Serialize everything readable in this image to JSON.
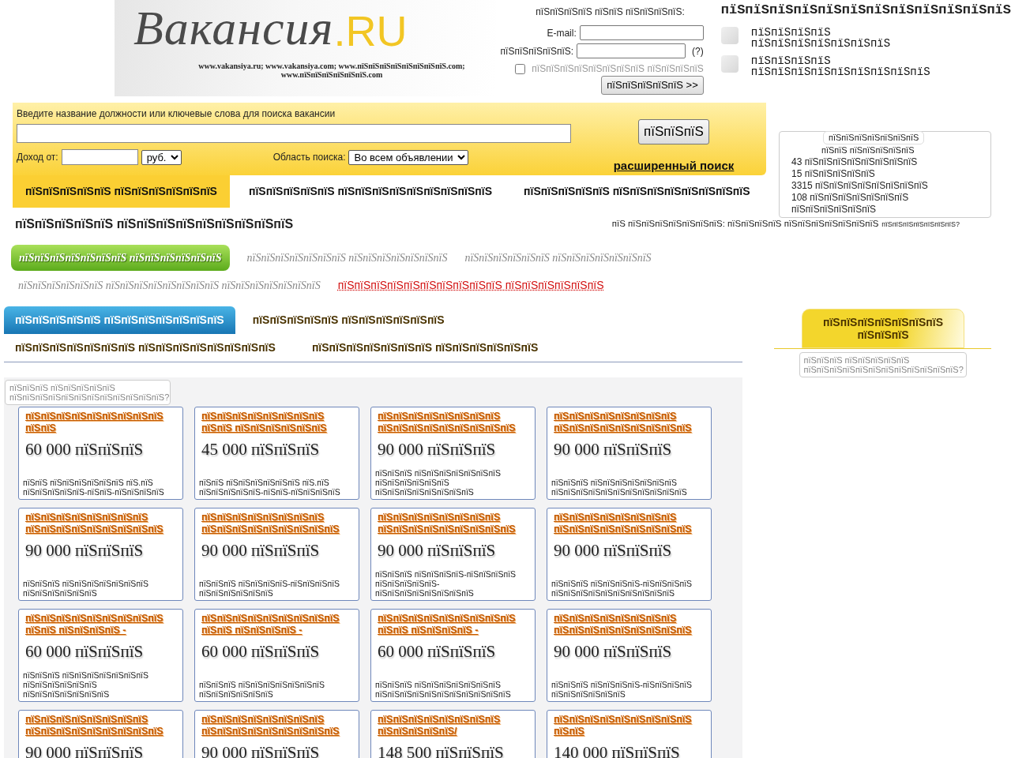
{
  "header": {
    "logo_text": "Вакансия",
    "logo_suffix": ".RU",
    "domains": "www.vakansiya.ru; www.vakansiya.com; www.пїЅпїЅпїЅпїЅпїЅпїЅпїЅпїЅ.com; www.пїЅпїЅпїЅпїЅпїЅпїЅ.com"
  },
  "login": {
    "title": "пїЅпїЅпїЅпїЅ пїЅпїЅ пїЅпїЅпїЅпїЅ:",
    "email_label": "E-mail:",
    "password_label": "пїЅпїЅпїЅпїЅпїЅ:",
    "help": "(?)",
    "remember": {
      "label": "пїЅпїЅпїЅпїЅпїЅпїЅпїЅпїЅ пїЅпїЅпїЅпїЅ",
      "checked": false
    },
    "button": "пїЅпїЅпїЅпїЅпїЅ >>"
  },
  "account": {
    "heading": "пїЅпїЅпїЅпїЅпїЅпїЅпїЅпїЅпїЅпїЅпїЅпїЅ",
    "links": [
      "пїЅпїЅпїЅпїЅ пїЅпїЅпїЅпїЅпїЅпїЅпїЅ",
      "пїЅпїЅпїЅпїЅ пїЅпїЅпїЅпїЅпїЅпїЅпїЅпїЅпїЅ"
    ]
  },
  "search": {
    "label": "Введите название должности или ключевые слова для поиска вакансии",
    "button": "пїЅпїЅпїЅ",
    "income_label": "Доход от:",
    "currency": "руб.",
    "area_label": "Область поиска:",
    "area": "Во всем объявлении",
    "advanced": "расширенный поиск"
  },
  "stats": {
    "title": "пїЅпїЅпїЅпїЅпїЅпїЅпїЅ",
    "subtitle": "пїЅпїЅ пїЅпїЅпїЅпїЅпїЅ",
    "lines": [
      "43 пїЅпїЅпїЅпїЅпїЅпїЅпїЅпїЅ",
      "15 пїЅпїЅпїЅпїЅпїЅ",
      "3315 пїЅпїЅпїЅпїЅпїЅпїЅпїЅпїЅ",
      "108 пїЅпїЅпїЅпїЅпїЅпїЅпїЅ",
      "пїЅпїЅпїЅпїЅпїЅпїЅ"
    ]
  },
  "tabs": [
    {
      "label": "пїЅпїЅпїЅпїЅпїЅ пїЅпїЅпїЅпїЅпїЅпїЅ",
      "selected": true
    },
    {
      "label": "пїЅпїЅпїЅпїЅпїЅ пїЅпїЅпїЅпїЅпїЅпїЅпїЅпїЅпїЅ",
      "selected": false
    },
    {
      "label": "пїЅпїЅпїЅпїЅпїЅ пїЅпїЅпїЅпїЅпїЅпїЅпїЅпїЅ",
      "selected": false
    }
  ],
  "section": {
    "heading": "пїЅпїЅпїЅпїЅпїЅ пїЅпїЅпїЅпїЅпїЅпїЅпїЅпїЅпїЅ",
    "note": "пїЅ пїЅпїЅпїЅпїЅпїЅпїЅпїЅ: пїЅпїЅпїЅпїЅ пїЅпїЅпїЅпїЅпїЅпїЅпїЅ",
    "note_link": "пїЅпїЅпїЅпїЅпїЅпїЅпїЅ?"
  },
  "categories": [
    {
      "label": "пїЅпїЅпїЅпїЅпїЅпїЅпїЅ пїЅпїЅпїЅпїЅпїЅпїЅ",
      "kind": "category",
      "selected": true
    },
    {
      "label": "пїЅпїЅпїЅпїЅпїЅпїЅпїЅ пїЅпїЅпїЅпїЅпїЅпїЅпїЅ",
      "kind": "category",
      "selected": false
    },
    {
      "label": "пїЅпїЅпїЅпїЅпїЅпїЅ пїЅпїЅпїЅпїЅпїЅпїЅпїЅ",
      "kind": "category",
      "selected": false
    },
    {
      "label": "пїЅпїЅпїЅпїЅпїЅпїЅ пїЅпїЅпїЅпїЅпїЅпїЅпїЅпїЅ пїЅпїЅпїЅпїЅпїЅпїЅпїЅ",
      "kind": "category",
      "selected": false
    },
    {
      "label": "пїЅпїЅпїЅпїЅпїЅпїЅпїЅпїЅпїЅпїЅ пїЅпїЅпїЅпїЅпїЅпїЅ",
      "kind": "highlight",
      "selected": false
    }
  ],
  "vacancy_tabs": [
    [
      {
        "label": "пїЅпїЅпїЅпїЅпїЅ пїЅпїЅпїЅпїЅпїЅпїЅпїЅ",
        "selected": true
      },
      {
        "label": "пїЅпїЅпїЅпїЅпїЅ пїЅпїЅпїЅпїЅпїЅпїЅ",
        "selected": false
      }
    ],
    [
      {
        "label": "пїЅпїЅпїЅпїЅпїЅпїЅпїЅ пїЅпїЅпїЅпїЅпїЅпїЅпїЅпїЅ",
        "selected": false
      },
      {
        "label": "пїЅпїЅпїЅпїЅпїЅпїЅпїЅ пїЅпїЅпїЅпїЅпїЅпїЅ",
        "selected": false
      }
    ]
  ],
  "tooltip": "пїЅпїЅпїЅ пїЅпїЅпїЅпїЅпїЅ пїЅпїЅпїЅпїЅпїЅпїЅпїЅпїЅпїЅпїЅпїЅпїЅ?",
  "side_panel": {
    "tab": "пїЅпїЅпїЅпїЅпїЅпїЅпїЅ пїЅпїЅпїЅ",
    "tooltip": "пїЅпїЅпїЅ пїЅпїЅпїЅпїЅпїЅ пїЅпїЅпїЅпїЅпїЅпїЅпїЅпїЅпїЅпїЅпїЅпїЅ?"
  },
  "cards": [
    {
      "title": "пїЅпїЅпїЅпїЅпїЅпїЅпїЅпїЅпїЅ пїЅпїЅ",
      "price": "60 000 пїЅпїЅпїЅ",
      "info": "пїЅпїЅ пїЅпїЅпїЅпїЅпїЅпїЅ пїЅ.пїЅ пїЅпїЅпїЅпїЅпїЅ-пїЅпїЅ-пїЅпїЅпїЅпїЅ"
    },
    {
      "title": "пїЅпїЅпїЅпїЅпїЅпїЅпїЅпїЅ пїЅпїЅ пїЅпїЅпїЅпїЅпїЅпїЅ",
      "price": "45 000 пїЅпїЅпїЅ",
      "info": "пїЅпїЅ пїЅпїЅпїЅпїЅпїЅпїЅ пїЅ.пїЅ пїЅпїЅпїЅпїЅпїЅ-пїЅпїЅ-пїЅпїЅпїЅпїЅ"
    },
    {
      "title": "пїЅпїЅпїЅпїЅпїЅпїЅпїЅпїЅ пїЅпїЅпїЅпїЅпїЅпїЅпїЅпїЅпїЅ",
      "price": "90 000 пїЅпїЅпїЅ",
      "info": "пїЅпїЅпїЅ пїЅпїЅпїЅпїЅпїЅпїЅпїЅ пїЅпїЅпїЅпїЅпїЅпїЅ пїЅпїЅпїЅпїЅпїЅпїЅпїЅпїЅ"
    },
    {
      "title": "пїЅпїЅпїЅпїЅпїЅпїЅпїЅпїЅ пїЅпїЅпїЅпїЅпїЅпїЅпїЅпїЅпїЅ",
      "price": "90 000 пїЅпїЅпїЅ",
      "info": "пїЅпїЅпїЅ пїЅпїЅпїЅпїЅпїЅпїЅпїЅ пїЅпїЅпїЅпїЅпїЅпїЅпїЅпїЅпїЅпїЅпїЅ"
    },
    {
      "title": "пїЅпїЅпїЅпїЅпїЅпїЅпїЅпїЅ пїЅпїЅпїЅпїЅпїЅпїЅпїЅпїЅпїЅ",
      "price": "90 000 пїЅпїЅпїЅ",
      "info": "пїЅпїЅпїЅ пїЅпїЅпїЅпїЅпїЅпїЅпїЅ пїЅпїЅпїЅпїЅпїЅпїЅ"
    },
    {
      "title": "пїЅпїЅпїЅпїЅпїЅпїЅпїЅпїЅ пїЅпїЅпїЅпїЅпїЅпїЅпїЅпїЅпїЅ",
      "price": "90 000 пїЅпїЅпїЅ",
      "info": "пїЅпїЅпїЅ пїЅпїЅпїЅпїЅ-пїЅпїЅпїЅпїЅ пїЅпїЅпїЅпїЅпїЅпїЅ"
    },
    {
      "title": "пїЅпїЅпїЅпїЅпїЅпїЅпїЅпїЅ пїЅпїЅпїЅпїЅпїЅпїЅпїЅпїЅпїЅ",
      "price": "90 000 пїЅпїЅпїЅ",
      "info": "пїЅпїЅпїЅ пїЅпїЅпїЅпїЅ-пїЅпїЅпїЅпїЅ пїЅпїЅпїЅпїЅпїЅ- пїЅпїЅпїЅпїЅпїЅпїЅпїЅпїЅ"
    },
    {
      "title": "пїЅпїЅпїЅпїЅпїЅпїЅпїЅпїЅ пїЅпїЅпїЅпїЅпїЅпїЅпїЅпїЅпїЅ",
      "price": "90 000 пїЅпїЅпїЅ",
      "info": "пїЅпїЅпїЅ пїЅпїЅпїЅпїЅ-пїЅпїЅпїЅпїЅ пїЅпїЅпїЅпїЅпїЅпїЅпїЅпїЅпїЅпїЅ"
    },
    {
      "title": "пїЅпїЅпїЅпїЅпїЅпїЅпїЅпїЅпїЅ пїЅпїЅ пїЅпїЅпїЅпїЅ -",
      "price": "60 000 пїЅпїЅпїЅ",
      "info": "пїЅпїЅпїЅ пїЅпїЅпїЅпїЅпїЅпїЅпїЅ пїЅпїЅпїЅпїЅпїЅпїЅ пїЅпїЅпїЅпїЅпїЅпїЅпїЅ"
    },
    {
      "title": "пїЅпїЅпїЅпїЅпїЅпїЅпїЅпїЅпїЅ пїЅпїЅ пїЅпїЅпїЅпїЅ -",
      "price": "60 000 пїЅпїЅпїЅ",
      "info": "пїЅпїЅпїЅ пїЅпїЅпїЅпїЅпїЅпїЅпїЅ пїЅпїЅпїЅпїЅпїЅпїЅ"
    },
    {
      "title": "пїЅпїЅпїЅпїЅпїЅпїЅпїЅпїЅпїЅ пїЅпїЅ пїЅпїЅпїЅпїЅ -",
      "price": "60 000 пїЅпїЅпїЅ",
      "info": "пїЅпїЅпїЅ пїЅпїЅпїЅпїЅпїЅпїЅпїЅ пїЅпїЅпїЅпїЅпїЅпїЅпїЅпїЅпїЅпїЅпїЅ"
    },
    {
      "title": "пїЅпїЅпїЅпїЅпїЅпїЅпїЅпїЅ пїЅпїЅпїЅпїЅпїЅпїЅпїЅпїЅпїЅ",
      "price": "90 000 пїЅпїЅпїЅ",
      "info": "пїЅпїЅпїЅ пїЅпїЅпїЅпїЅ-пїЅпїЅпїЅпїЅ пїЅпїЅпїЅпїЅпїЅпїЅ"
    },
    {
      "title": "пїЅпїЅпїЅпїЅпїЅпїЅпїЅпїЅ пїЅпїЅпїЅпїЅпїЅпїЅпїЅпїЅпїЅ",
      "price": "90 000 пїЅпїЅпїЅ"
    },
    {
      "title": "пїЅпїЅпїЅпїЅпїЅпїЅпїЅпїЅ пїЅпїЅпїЅпїЅпїЅпїЅпїЅпїЅпїЅ",
      "price": "90 000 пїЅпїЅпїЅ"
    },
    {
      "title": "пїЅпїЅпїЅпїЅпїЅпїЅпїЅпїЅ пїЅпїЅпїЅпїЅпїЅ/",
      "price": "148 500 пїЅпїЅпїЅ"
    },
    {
      "title": "пїЅпїЅпїЅпїЅпїЅпїЅпїЅпїЅпїЅ пїЅпїЅ",
      "price": "140 000 пїЅпїЅпїЅ"
    }
  ]
}
